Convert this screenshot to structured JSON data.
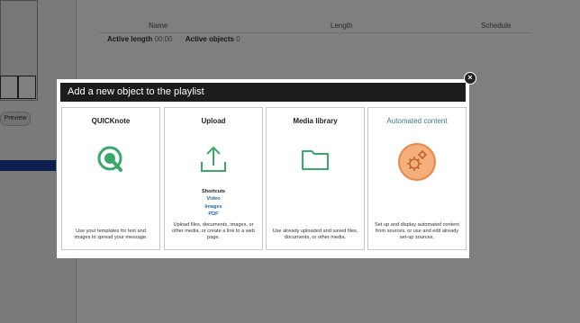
{
  "background": {
    "preview_label": "Preview",
    "table_headers": [
      "Name",
      "Length",
      "Schedule"
    ],
    "active_length_label": "Active length",
    "active_length_value": "00:00",
    "active_objects_label": "Active objects",
    "active_objects_value": "0"
  },
  "dialog": {
    "title": "Add a new object to the playlist",
    "close_icon": "×",
    "cards": [
      {
        "title": "QUICKnote",
        "icon": "quicknote-icon",
        "description": "Use your templates for text and images to spread your message."
      },
      {
        "title": "Upload",
        "icon": "upload-icon",
        "shortcuts_title": "Shortcuts",
        "shortcuts": [
          "Video",
          "Images",
          "PDF"
        ],
        "description": "Upload files, documents, images, or other media, or create a link to a web page."
      },
      {
        "title": "Media library",
        "icon": "folder-icon",
        "description": "Use already uploaded and saved files, documents, or other media."
      },
      {
        "title": "Automated content",
        "icon": "gears-icon",
        "description": "Set up and display automated content from sources, or use and edit already set-up sources."
      }
    ]
  },
  "colors": {
    "accent_green": "#3aa86a",
    "automated_orange": "#f0a060",
    "link_blue": "#2c6aa0",
    "header_black": "#1c1c1c"
  }
}
